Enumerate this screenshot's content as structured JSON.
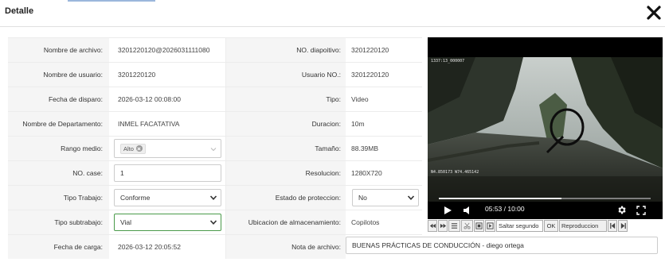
{
  "dialog": {
    "title": "Detalle"
  },
  "form": {
    "nombre_archivo": {
      "label": "Nombre de archivo:",
      "value": "3201220120@2026031111080"
    },
    "no_dispositivo": {
      "label": "NO. diapoitivo:",
      "value": "3201220120"
    },
    "nombre_usuario": {
      "label": "Nombre de usuario:",
      "value": "3201220120"
    },
    "usuario_no": {
      "label": "Usuario NO.:",
      "value": "3201220120"
    },
    "fecha_disparo": {
      "label": "Fecha de disparo:",
      "value": "2026-03-12 00:08:00"
    },
    "tipo": {
      "label": "Tipo:",
      "value": "Video"
    },
    "departamento": {
      "label": "Nombre de Departamento:",
      "value": "INMEL FACATATIVA"
    },
    "duracion": {
      "label": "Duracion:",
      "value": "10m"
    },
    "rango_medio": {
      "label": "Rango medio:",
      "tag": "Alto"
    },
    "tamano": {
      "label": "Tamaño:",
      "value": "88.39MB"
    },
    "no_case": {
      "label": "NO. case:",
      "value": "1"
    },
    "resolucion": {
      "label": "Resolucion:",
      "value": "1280X720"
    },
    "tipo_trabajo": {
      "label": "Tipo Trabajo:",
      "value": "Conforme"
    },
    "estado_proteccion": {
      "label": "Estado de proteccion:",
      "value": "No"
    },
    "tipo_subtrabajo": {
      "label": "Tipo subtrabajo:",
      "value": "Vial"
    },
    "ubicacion": {
      "label": "Ubicacion de almacenamiento:",
      "value": "Copilotos"
    },
    "fecha_carga": {
      "label": "Fecha de carga:",
      "value": "2026-03-12 20:05:52"
    },
    "nota_archivo": {
      "label": "Nota de archivo:",
      "value": "BUENAS PRÁCTICAS DE CONDUCCIÓN - diego ortega"
    }
  },
  "player": {
    "overlay_top": "1337:13_000007",
    "overlay_gps": "N4.850173 W74.465142",
    "time": "05:53 / 10:00",
    "progress_fraction": 0.58
  },
  "toolbar": {
    "skip_label": "Saltar segundo",
    "ok_label": "OK",
    "playback_label": "Reproduccion"
  },
  "colors": {
    "active_border": "#4a9a4a",
    "label_bg": "#f5f5f5"
  }
}
